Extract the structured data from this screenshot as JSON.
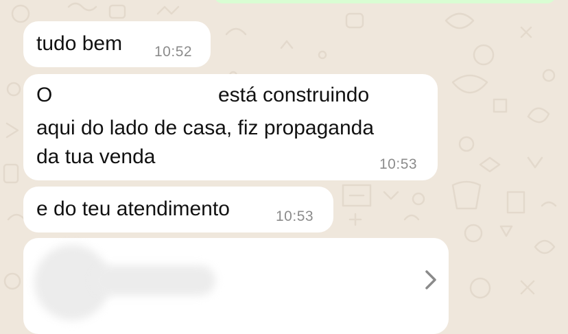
{
  "messages": [
    {
      "lines": [
        "tudo bem"
      ],
      "time": "10:52"
    },
    {
      "lines": [
        "O",
        "está construindo",
        "aqui do lado de casa, fiz propaganda",
        "da tua venda"
      ],
      "time": "10:53"
    },
    {
      "lines": [
        "e do teu atendimento"
      ],
      "time": "10:53"
    }
  ],
  "preview_card": {
    "icon": "chevron-right-icon"
  },
  "colors": {
    "wallpaper": "#efe7dc",
    "incoming_bubble": "#ffffff",
    "outgoing_bubble": "#d9fdd3",
    "timestamp": "#8b8b8b"
  }
}
